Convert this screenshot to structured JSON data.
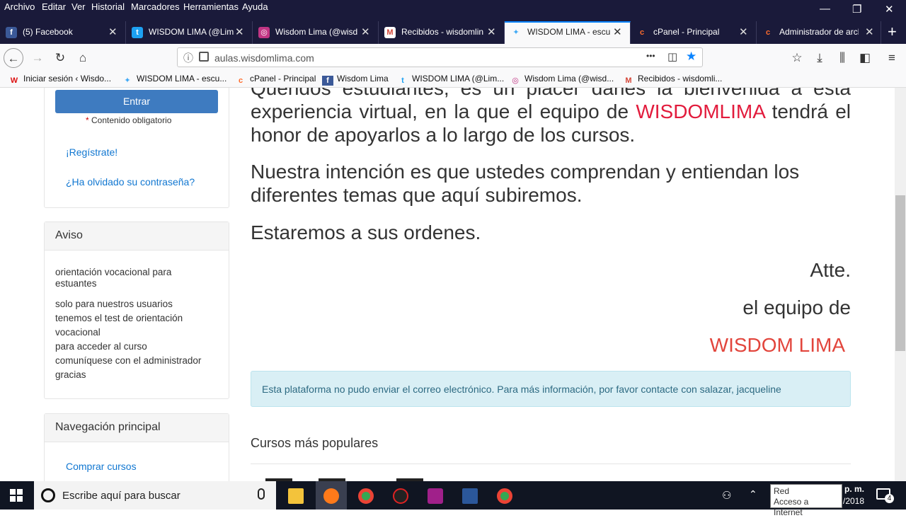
{
  "menubar": {
    "items": [
      "Archivo",
      "Editar",
      "Ver",
      "Historial",
      "Marcadores",
      "Herramientas",
      "Ayuda"
    ],
    "minimize": "—",
    "restore": "❐",
    "close": "✕"
  },
  "tabs": [
    {
      "title": "(5) Facebook",
      "icon": "facebook-icon",
      "color": "#3b5998",
      "glyph": "f"
    },
    {
      "title": "WISDOM LIMA (@Lim",
      "icon": "twitter-icon",
      "color": "#1da1f2",
      "glyph": "t"
    },
    {
      "title": "Wisdom Lima (@wisd",
      "icon": "instagram-icon",
      "color": "#c13584",
      "glyph": "◎"
    },
    {
      "title": "Recibidos - wisdomlin",
      "icon": "gmail-icon",
      "color": "#d44638",
      "glyph": "M"
    },
    {
      "title": "WISDOM LIMA - escu",
      "icon": "wisdom-logo-icon",
      "color": "#3fa9f5",
      "glyph": "✦"
    },
    {
      "title": "cPanel - Principal",
      "icon": "cpanel-icon",
      "color": "#ff6c2c",
      "glyph": "c"
    },
    {
      "title": "Administrador de arch",
      "icon": "cpanel-icon",
      "color": "#ff6c2c",
      "glyph": "c"
    }
  ],
  "tab_close": "✕",
  "new_tab": "+",
  "nav": {
    "back": "←",
    "forward": "→",
    "reload": "↻",
    "home": "⌂",
    "url": "aulas.wisdomlima.com",
    "info": "ⓘ",
    "more": "•••",
    "pocket": "◫",
    "star": "★"
  },
  "toolbar_right": {
    "library": "⫼",
    "sidebar": "◧",
    "download": "⤓",
    "reader": "☆",
    "menu": "≡"
  },
  "bookmarks": [
    {
      "label": "Iniciar sesión ‹ Wisdo...",
      "icon": "wordpress-icon",
      "color": "#d11",
      "glyph": "W"
    },
    {
      "label": "WISDOM LIMA - escu...",
      "icon": "wisdom-logo-icon",
      "color": "#3fa9f5",
      "glyph": "✦"
    },
    {
      "label": "cPanel - Principal",
      "icon": "cpanel-icon",
      "color": "#ff6c2c",
      "glyph": "c"
    },
    {
      "label": "Wisdom Lima",
      "icon": "facebook-icon",
      "color": "#3b5998",
      "glyph": "f"
    },
    {
      "label": "WISDOM LIMA (@Lim...",
      "icon": "twitter-icon",
      "color": "#1da1f2",
      "glyph": "t"
    },
    {
      "label": "Wisdom Lima (@wisd...",
      "icon": "instagram-icon",
      "color": "#c13584",
      "glyph": "◎"
    },
    {
      "label": "Recibidos - wisdomli...",
      "icon": "gmail-icon",
      "color": "#d44638",
      "glyph": "M"
    }
  ],
  "login": {
    "enter": "Entrar",
    "required_mark": "*",
    "required": "Contenido obligatorio",
    "register": "¡Regístrate!",
    "forgot": "¿Ha olvidado su contraseña?"
  },
  "aviso": {
    "heading": "Aviso",
    "title": "orientación vocacional para estuantes",
    "lines": [
      "solo para nuestros usuarios",
      "tenemos el test de orientación",
      "vocacional",
      "para acceder al curso",
      "comuníquese con el administrador",
      "gracias"
    ]
  },
  "navigation": {
    "heading": "Navegación principal",
    "link": "Comprar cursos"
  },
  "main": {
    "p1_a": "Queridos estudiantes, es un placer darles la bienvenida a esta experiencia virtual, en la que el equipo de ",
    "p1_brand": "WISDOMLIMA",
    "p1_b": " tendrá el honor de apoyarlos a lo largo de los cursos.",
    "p2": "Nuestra intención es que ustedes comprendan y entiendan los diferentes temas que aquí subiremos.",
    "p3": "Estaremos a sus ordenes.",
    "atte": "Atte.",
    "team": "el equipo de",
    "brand": "WISDOM LIMA",
    "alert": "Esta plataforma no pudo enviar el correo electrónico. Para más información, por favor contacte con salazar, jacqueline",
    "popular": "Cursos más populares"
  },
  "taskbar": {
    "search": "Escribe aquí para buscar",
    "clock_top": "p. m.",
    "clock_bottom": "/2018",
    "notif_count": "4"
  },
  "tooltip": {
    "line1": "Red",
    "line2": "Acceso a Internet"
  }
}
